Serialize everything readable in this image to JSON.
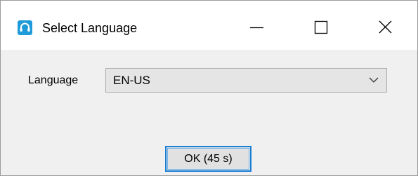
{
  "window": {
    "title": "Select Language",
    "app_icon": "headset-icon",
    "controls": {
      "minimize_icon": "minimize-icon",
      "maximize_icon": "maximize-icon",
      "close_icon": "close-icon"
    }
  },
  "form": {
    "language_label": "Language",
    "language_value": "EN-US",
    "dropdown_icon": "chevron-down-icon"
  },
  "actions": {
    "ok_label": "OK (45 s)"
  },
  "colors": {
    "accent": "#1a7fd4",
    "app_icon": "#1e9bd8",
    "dialog_bg": "#f0f0f0",
    "titlebar_bg": "#ffffff"
  }
}
